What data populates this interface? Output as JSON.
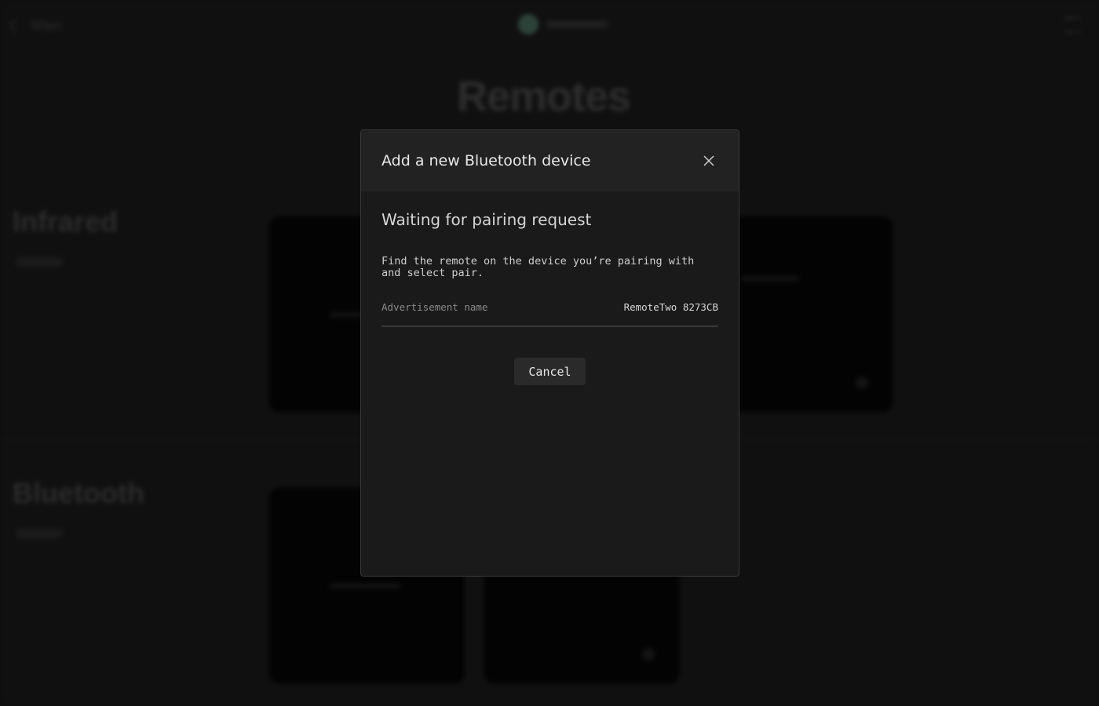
{
  "background": {
    "nav": {
      "back_label": "Main"
    },
    "page_title": "Remotes",
    "sections": [
      {
        "label": "Infrared"
      },
      {
        "label": "Bluetooth"
      }
    ]
  },
  "modal": {
    "title": "Add a new Bluetooth device",
    "close_icon": "close-icon",
    "status_heading": "Waiting for pairing request",
    "instructions": "Find the remote on the device you’re pairing with and select pair.",
    "advertisement": {
      "label": "Advertisement name",
      "value": "RemoteTwo 8273CB"
    },
    "cancel_label": "Cancel"
  },
  "colors": {
    "page_bg": "#161616",
    "modal_bg": "#1a1a1a",
    "modal_header_bg": "#222222",
    "button_bg": "#2a2a2a",
    "logo_accent": "#3d5a4c"
  }
}
